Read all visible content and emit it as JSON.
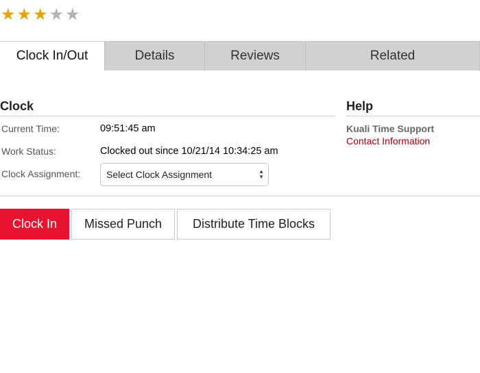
{
  "rating": {
    "value": 3,
    "max": 5,
    "on_color": "#e5a50a",
    "off_color": "#b3b3b3"
  },
  "tabs": [
    {
      "label": "Clock In/Out",
      "active": true
    },
    {
      "label": "Details",
      "active": false
    },
    {
      "label": "Reviews",
      "active": false
    },
    {
      "label": "Related",
      "active": false
    }
  ],
  "clock": {
    "title": "Clock",
    "current_time_label": "Current Time:",
    "current_time_value": "09:51:45 am",
    "work_status_label": "Work Status:",
    "work_status_value": "Clocked out since 10/21/14 10:34:25 am",
    "assignment_label": "Clock Assignment:",
    "assignment_selected": "Select Clock Assignment"
  },
  "help": {
    "title": "Help",
    "support_name": "Kuali Time Support",
    "contact_link": "Contact Information"
  },
  "actions": {
    "clock_in": "Clock In",
    "missed_punch": "Missed Punch",
    "distribute": "Distribute Time Blocks"
  },
  "colors": {
    "accent_red": "#e8132e",
    "link_red": "#a3000c",
    "tab_gray": "#d1d1d1"
  }
}
